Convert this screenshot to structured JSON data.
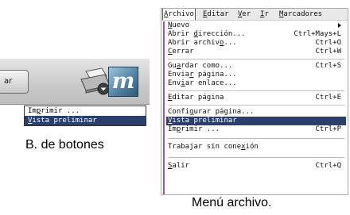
{
  "toolbar_panel": {
    "button_fragment": "ar",
    "popup_items": [
      "Imprimir ...",
      "Vista preliminar"
    ],
    "popup_selected_index": 1,
    "caption": "B. de botones"
  },
  "menu_panel": {
    "menubar": [
      "Archivo",
      "Editar",
      "Ver",
      "Ir",
      "Marcadores"
    ],
    "open_menu": "Archivo",
    "caption": "Menú archivo.",
    "items": [
      {
        "label": "Nuevo",
        "shortcut": "",
        "submenu": true
      },
      {
        "label": "Abrir dirección...",
        "shortcut": "Ctrl+Mays+L"
      },
      {
        "label": "Abrir archivo...",
        "shortcut": "Ctrl+O"
      },
      {
        "label": "Cerrar",
        "shortcut": "Ctrl+W"
      },
      {
        "label": "Guardar como...",
        "shortcut": "Ctrl+S"
      },
      {
        "label": "Enviar página...",
        "shortcut": ""
      },
      {
        "label": "Enviar enlace...",
        "shortcut": ""
      },
      {
        "label": "Editar página",
        "shortcut": "Ctrl+E"
      },
      {
        "label": "Configurar página...",
        "shortcut": ""
      },
      {
        "label": "Vista preliminar",
        "shortcut": "",
        "selected": true
      },
      {
        "label": "Imprimir ...",
        "shortcut": "Ctrl+P"
      },
      {
        "label": "Trabajar sin conexión",
        "shortcut": ""
      },
      {
        "label": "Salir",
        "shortcut": "Ctrl+Q"
      }
    ]
  },
  "colors": {
    "selection": "#2a3f6a",
    "menu_left_accent": "#9b5aa8",
    "icon_blue": "#4f7f9f"
  }
}
